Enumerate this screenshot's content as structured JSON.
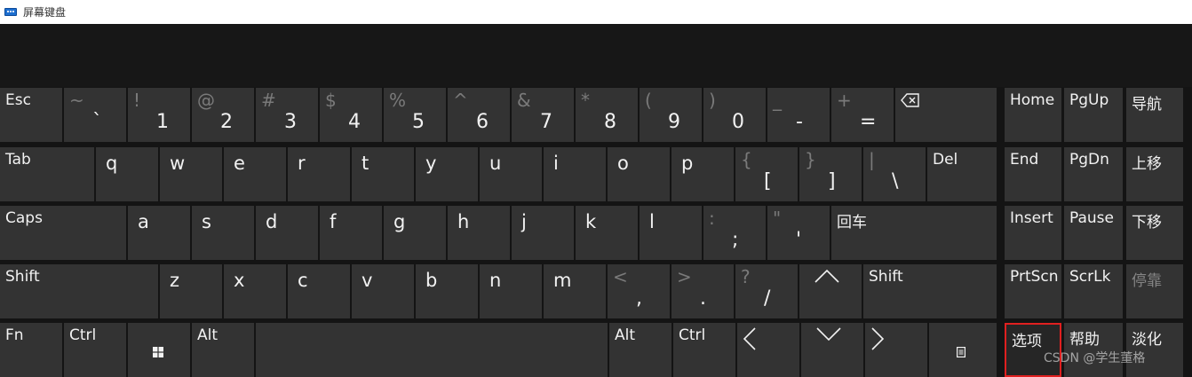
{
  "window": {
    "title": "屏幕键盘"
  },
  "row1": [
    {
      "label": "Esc"
    },
    {
      "shift": "~",
      "main": "`"
    },
    {
      "shift": "!",
      "main": "1"
    },
    {
      "shift": "@",
      "main": "2"
    },
    {
      "shift": "#",
      "main": "3"
    },
    {
      "shift": "$",
      "main": "4"
    },
    {
      "shift": "%",
      "main": "5"
    },
    {
      "shift": "^",
      "main": "6"
    },
    {
      "shift": "&",
      "main": "7"
    },
    {
      "shift": "*",
      "main": "8"
    },
    {
      "shift": "(",
      "main": "9"
    },
    {
      "shift": ")",
      "main": "0"
    },
    {
      "shift": "_",
      "main": "-"
    },
    {
      "shift": "+",
      "main": "="
    },
    {
      "icon": "backspace-icon"
    }
  ],
  "row2": [
    {
      "label": "Tab"
    },
    {
      "main": "q"
    },
    {
      "main": "w"
    },
    {
      "main": "e"
    },
    {
      "main": "r"
    },
    {
      "main": "t"
    },
    {
      "main": "y"
    },
    {
      "main": "u"
    },
    {
      "main": "i"
    },
    {
      "main": "o"
    },
    {
      "main": "p"
    },
    {
      "shift": "{",
      "main": "["
    },
    {
      "shift": "}",
      "main": "]"
    },
    {
      "shift": "|",
      "main": "\\"
    },
    {
      "label": "Del"
    }
  ],
  "row3": [
    {
      "label": "Caps"
    },
    {
      "main": "a"
    },
    {
      "main": "s"
    },
    {
      "main": "d"
    },
    {
      "main": "f"
    },
    {
      "main": "g"
    },
    {
      "main": "h"
    },
    {
      "main": "j"
    },
    {
      "main": "k"
    },
    {
      "main": "l"
    },
    {
      "shift": ":",
      "main": ";"
    },
    {
      "shift": "\"",
      "main": "'"
    },
    {
      "label": "回车"
    }
  ],
  "row4": [
    {
      "label": "Shift"
    },
    {
      "main": "z"
    },
    {
      "main": "x"
    },
    {
      "main": "c"
    },
    {
      "main": "v"
    },
    {
      "main": "b"
    },
    {
      "main": "n"
    },
    {
      "main": "m"
    },
    {
      "shift": "<",
      "main": ","
    },
    {
      "shift": ">",
      "main": "."
    },
    {
      "shift": "?",
      "main": "/"
    },
    {
      "icon": "arrow-up-icon"
    },
    {
      "label": "Shift"
    }
  ],
  "row5": [
    {
      "label": "Fn"
    },
    {
      "label": "Ctrl"
    },
    {
      "icon": "windows-icon"
    },
    {
      "label": "Alt"
    },
    {
      "label": ""
    },
    {
      "label": "Alt"
    },
    {
      "label": "Ctrl"
    },
    {
      "icon": "arrow-left-icon"
    },
    {
      "icon": "arrow-down-icon"
    },
    {
      "icon": "arrow-right-icon"
    },
    {
      "icon": "context-menu-icon"
    }
  ],
  "side": [
    {
      "label": "Home"
    },
    {
      "label": "PgUp"
    },
    {
      "label": "导航"
    },
    {
      "label": "End"
    },
    {
      "label": "PgDn"
    },
    {
      "label": "上移"
    },
    {
      "label": "Insert"
    },
    {
      "label": "Pause"
    },
    {
      "label": "下移"
    },
    {
      "label": "PrtScn"
    },
    {
      "label": "ScrLk"
    },
    {
      "label": "停靠",
      "disabled": true
    },
    {
      "label": "选项",
      "highlighted": true
    },
    {
      "label": "帮助"
    },
    {
      "label": "淡化"
    }
  ],
  "watermark": "CSDN @学生董格"
}
